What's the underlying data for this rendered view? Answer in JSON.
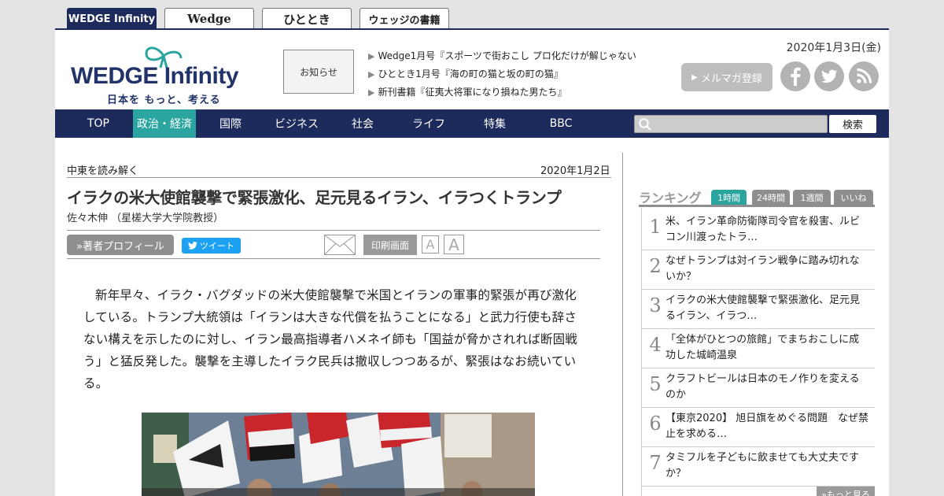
{
  "site_tabs": [
    {
      "label": "WEDGE Infinity"
    },
    {
      "label": "Wedge"
    },
    {
      "label": "ひととき"
    },
    {
      "label": "ウェッジの書籍"
    }
  ],
  "header": {
    "logo_word_a": "WEDGE",
    "logo_word_b": "Infinity",
    "logo_tagline": "日本を もっと、考える",
    "notice_label": "お知らせ",
    "news": [
      "Wedge1月号『スポーツで街おこし プロ化だけが解じゃない",
      "ひととき1月号『海の町の猫と坂の町の猫』",
      "新刊書籍『征夷大将軍になり損ねた男たち』"
    ],
    "date": "2020年1月3日(金)",
    "mailmag_label": "メルマガ登録",
    "social": [
      "facebook-icon",
      "twitter-icon",
      "rss-icon"
    ]
  },
  "nav": {
    "items": [
      "TOP",
      "政治・経済",
      "国際",
      "ビジネス",
      "社会",
      "ライフ",
      "特集",
      "BBC"
    ],
    "active": "政治・経済",
    "search_button": "検索"
  },
  "article": {
    "series": "中東を読み解く",
    "date": "2020年1月2日",
    "title": "イラクの米大使館襲撃で緊張激化、足元見るイラン、イラつくトランプ",
    "author": "佐々木伸 （星槎大学大学院教授）",
    "profile_button": "»著者プロフィール",
    "tweet_button": "ツイート",
    "print_button": "印刷画面",
    "font_small": "A",
    "font_large": "A",
    "body": "新年早々、イラク・バグダッドの米大使館襲撃で米国とイランの軍事的緊張が再び激化している。トランプ大統領は「イランは大きな代償を払うことになる」と武力行使も辞さない構えを示したのに対し、イラン最高指導者ハメネイ師も「国益が脅かされれば断固戦う」と猛反発した。襲撃を主導したイラク民兵は撤収しつつあるが、緊張はなお続いている。"
  },
  "ranking": {
    "title": "ランキング",
    "tabs": [
      "1時間",
      "24時間",
      "1週間",
      "いいね"
    ],
    "active_tab": "1時間",
    "items": [
      {
        "num": "1",
        "text": "米、イラン革命防衛隊司令官を殺害、ルビコン川渡ったトラ…"
      },
      {
        "num": "2",
        "text": "なぜトランプは対イラン戦争に踏み切れないか？"
      },
      {
        "num": "3",
        "text": "イラクの米大使館襲撃で緊張激化、足元見るイラン、イラつ…"
      },
      {
        "num": "4",
        "text": "「全体がひとつの旅館」でまちおこしに成功した城崎温泉"
      },
      {
        "num": "5",
        "text": "クラフトビールは日本のモノ作りを変えるのか"
      },
      {
        "num": "6",
        "text": "【東京2020】 旭日旗をめぐる問題　なぜ禁止を求める…"
      },
      {
        "num": "7",
        "text": "タミフルを子どもに飲ませても大丈夫ですか？"
      }
    ],
    "more_label": "»もっと見る"
  },
  "colors": {
    "navy": "#1d2b5c",
    "teal": "#2aa5a0",
    "grey_button": "#9a9a9a",
    "twitter": "#1da1f2"
  }
}
